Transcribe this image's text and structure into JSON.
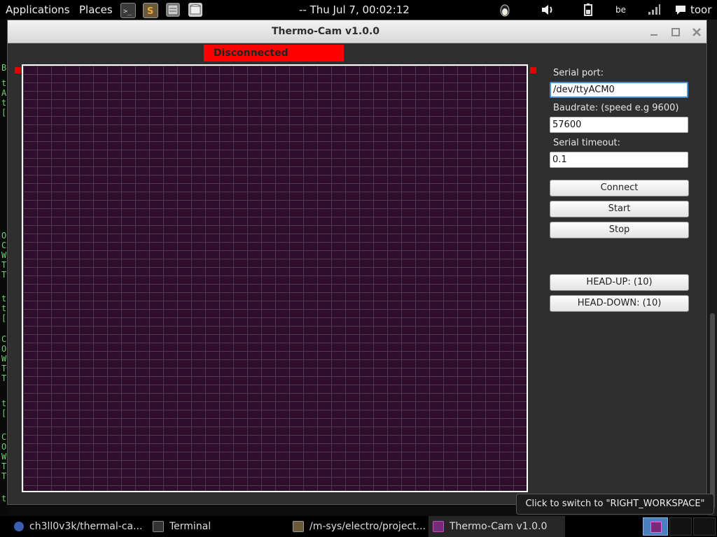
{
  "top_panel": {
    "applications": "Applications",
    "places": "Places",
    "clock": "-- Thu Jul  7, 00:02:12",
    "keyboard_layout": "be",
    "user": "toor",
    "launcher_icons": [
      "terminal-icon",
      "sublime-text-icon",
      "file-manager-icon",
      "disk-icon"
    ],
    "tray_icons": [
      "penguin-icon",
      "volume-icon",
      "battery-icon",
      "signal-icon",
      "chat-icon"
    ]
  },
  "window": {
    "title": "Thermo-Cam v1.0.0",
    "controls": [
      "minimize-icon",
      "maximize-icon",
      "close-icon"
    ]
  },
  "status": {
    "text": "Disconnected",
    "color": "#ff0000"
  },
  "thermal_grid": {
    "cell_color": "#2f0d2d",
    "line_color": "#4a3a4a"
  },
  "form": {
    "serial_port_label": "Serial port:",
    "serial_port_value": "/dev/ttyACM0",
    "baudrate_label": "Baudrate: (speed e.g 9600)",
    "baudrate_value": "57600",
    "timeout_label": "Serial timeout:",
    "timeout_value": "0.1"
  },
  "buttons": {
    "connect": "Connect",
    "start": "Start",
    "stop": "Stop",
    "head_up": "HEAD-UP: (10)",
    "head_down": "HEAD-DOWN: (10)"
  },
  "tooltip": "Click to switch to \"RIGHT_WORKSPACE\"",
  "taskbar": {
    "items": [
      {
        "label": "ch3ll0v3k/thermal-ca...",
        "icon": "browser-icon"
      },
      {
        "label": "Terminal",
        "icon": "terminal-icon"
      },
      {
        "label": "/m-sys/electro/project...",
        "icon": "editor-icon"
      },
      {
        "label": "Thermo-Cam v1.0.0",
        "icon": "thermocam-icon"
      }
    ]
  },
  "terminal_letters": [
    "B",
    "t",
    "A",
    "t",
    "[",
    "O",
    "C",
    "W",
    "T",
    "T",
    "t",
    "t",
    "[",
    "C",
    "O",
    "W",
    "T",
    "T",
    "t",
    "[",
    "C",
    "O",
    "W",
    "T",
    "T",
    "t"
  ],
  "colors": {
    "accent_focus": "#4a90d9",
    "terminal_text": "#6fd26f"
  }
}
